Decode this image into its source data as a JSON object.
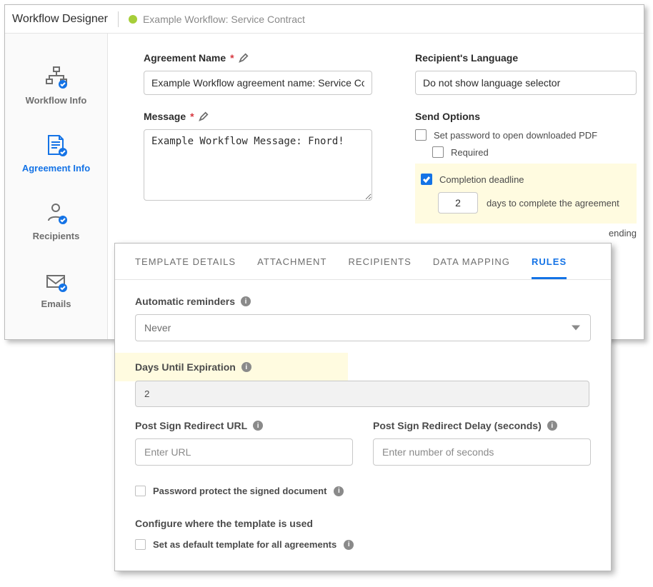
{
  "header": {
    "title": "Workflow Designer",
    "workflow_name": "Example Workflow: Service Contract"
  },
  "sidebar": {
    "items": [
      {
        "label": "Workflow Info"
      },
      {
        "label": "Agreement Info"
      },
      {
        "label": "Recipients"
      },
      {
        "label": "Emails"
      }
    ]
  },
  "agreement": {
    "name_label": "Agreement Name",
    "name_value": "Example Workflow agreement name: Service Contract",
    "message_label": "Message",
    "message_value": "Example Workflow Message: Fnord!",
    "recipient_lang_label": "Recipient's Language",
    "recipient_lang_value": "Do not show language selector",
    "send_options_label": "Send Options",
    "option_pdf_pw": "Set password to open downloaded PDF",
    "option_required": "Required",
    "option_deadline": "Completion deadline",
    "deadline_days": "2",
    "deadline_suffix": "days to complete the agreement",
    "ending_fragment": "ending"
  },
  "template": {
    "tabs": [
      "TEMPLATE DETAILS",
      "ATTACHMENT",
      "RECIPIENTS",
      "DATA MAPPING",
      "RULES"
    ],
    "auto_reminders_label": "Automatic reminders",
    "auto_reminders_value": "Never",
    "days_until_label": "Days Until Expiration",
    "days_until_value": "2",
    "redirect_url_label": "Post Sign Redirect URL",
    "redirect_url_placeholder": "Enter URL",
    "redirect_delay_label": "Post Sign Redirect Delay (seconds)",
    "redirect_delay_placeholder": "Enter number of seconds",
    "pw_protect_label": "Password protect the signed document",
    "configure_section": "Configure where the template is used",
    "default_template_label": "Set as default template for all agreements"
  }
}
